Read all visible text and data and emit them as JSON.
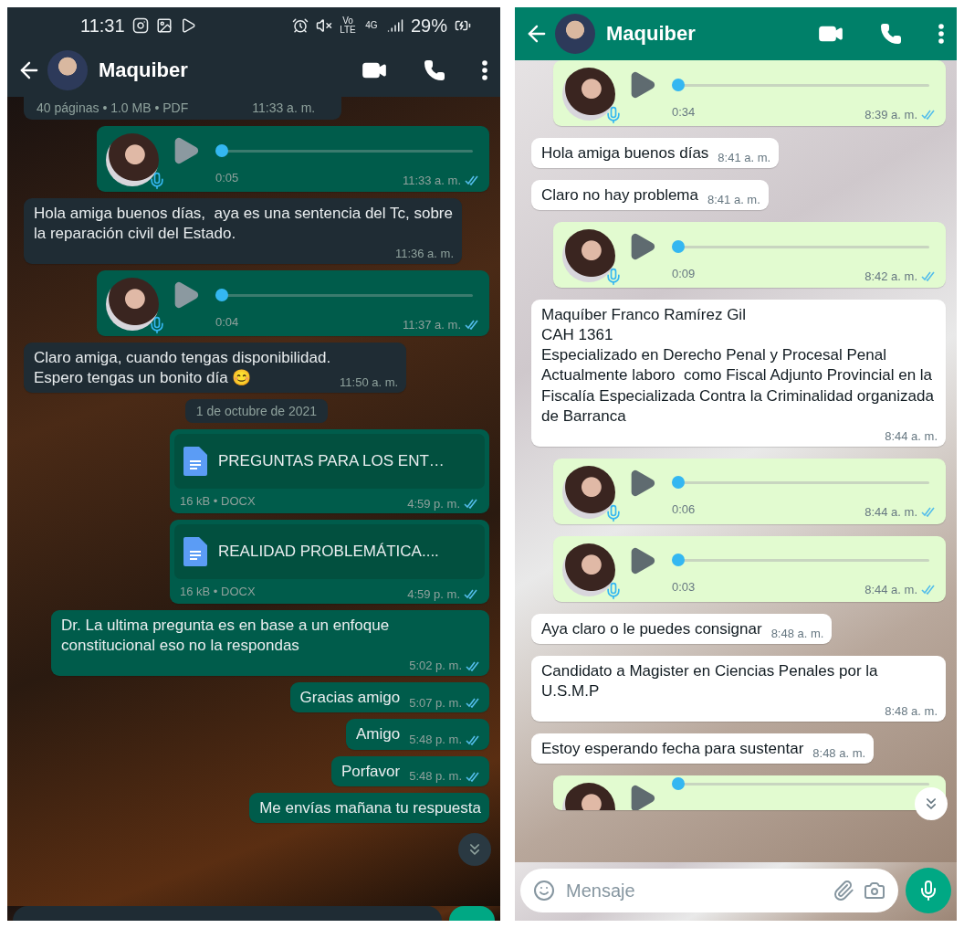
{
  "screens": [
    {
      "dark_mode": true,
      "status_bar": {
        "time": "11:31",
        "indicators": [
          "Vo LTE",
          "4G"
        ],
        "battery": "29%"
      },
      "header": {
        "name": "Maquiber"
      },
      "messages": [
        {
          "kind": "document_tail",
          "outgoing": false,
          "meta": "40 páginas • 1.0 MB • PDF",
          "time": "11:33 a. m."
        },
        {
          "kind": "voice",
          "outgoing": true,
          "duration": "0:05",
          "time": "11:33 a. m.",
          "read": true
        },
        {
          "kind": "text",
          "outgoing": false,
          "text": "Hola amiga buenos días,  aya es una sentencia del Tc, sobre la reparación civil del Estado.",
          "time": "11:36 a. m."
        },
        {
          "kind": "voice",
          "outgoing": true,
          "duration": "0:04",
          "time": "11:37 a. m.",
          "read": true
        },
        {
          "kind": "text",
          "outgoing": false,
          "text": "Claro amiga, cuando tengas disponibilidad.\nEspero tengas un bonito día 😊",
          "time": "11:50 a. m."
        },
        {
          "kind": "date",
          "text": "1 de octubre de 2021"
        },
        {
          "kind": "document",
          "outgoing": true,
          "file": "PREGUNTAS PARA LOS ENT…",
          "meta": "16 kB • DOCX",
          "time": "4:59 p. m.",
          "read": true
        },
        {
          "kind": "document",
          "outgoing": true,
          "file": "REALIDAD PROBLEMÁTICA....",
          "meta": "16 kB • DOCX",
          "time": "4:59 p. m.",
          "read": true
        },
        {
          "kind": "text",
          "outgoing": true,
          "text": "Dr. La ultima pregunta es en base a un enfoque constitucional eso no la respondas",
          "time": "5:02 p. m.",
          "read": true
        },
        {
          "kind": "text",
          "outgoing": true,
          "text": "Gracias amigo",
          "time": "5:07 p. m.",
          "read": true
        },
        {
          "kind": "text",
          "outgoing": true,
          "text": "Amigo",
          "time": "5:48 p. m.",
          "read": true
        },
        {
          "kind": "text",
          "outgoing": true,
          "text": "Porfavor",
          "time": "5:48 p. m.",
          "read": true
        },
        {
          "kind": "text_tail",
          "outgoing": true,
          "text": "Me envías mañana tu respuesta"
        }
      ]
    },
    {
      "dark_mode": false,
      "header": {
        "name": "Maquiber"
      },
      "messages": [
        {
          "kind": "voice",
          "outgoing": true,
          "duration": "0:34",
          "time": "8:39 a. m.",
          "read": true
        },
        {
          "kind": "text",
          "outgoing": false,
          "text": "Hola amiga buenos días",
          "time": "8:41 a. m."
        },
        {
          "kind": "text",
          "outgoing": false,
          "text": "Claro no hay problema",
          "time": "8:41 a. m."
        },
        {
          "kind": "voice",
          "outgoing": true,
          "duration": "0:09",
          "time": "8:42 a. m.",
          "read": true
        },
        {
          "kind": "text",
          "outgoing": false,
          "text": "Maquíber Franco Ramírez Gil\nCAH 1361\nEspecializado en Derecho Penal y Procesal Penal\nActualmente laboro  como Fiscal Adjunto Provincial en la Fiscalía Especializada Contra la Criminalidad organizada de Barranca",
          "time": "8:44 a. m."
        },
        {
          "kind": "voice",
          "outgoing": true,
          "duration": "0:06",
          "time": "8:44 a. m.",
          "read": true
        },
        {
          "kind": "voice",
          "outgoing": true,
          "duration": "0:03",
          "time": "8:44 a. m.",
          "read": true
        },
        {
          "kind": "text",
          "outgoing": false,
          "text": "Aya claro o le puedes consignar",
          "time": "8:48 a. m."
        },
        {
          "kind": "text",
          "outgoing": false,
          "text": "Candidato a Magister en Ciencias Penales por la U.S.M.P",
          "time": "8:48 a. m."
        },
        {
          "kind": "text",
          "outgoing": false,
          "text": "Estoy esperando fecha para sustentar",
          "time": "8:48 a. m."
        },
        {
          "kind": "voice_tail",
          "outgoing": true
        }
      ],
      "composer": {
        "placeholder": "Mensaje"
      }
    }
  ]
}
